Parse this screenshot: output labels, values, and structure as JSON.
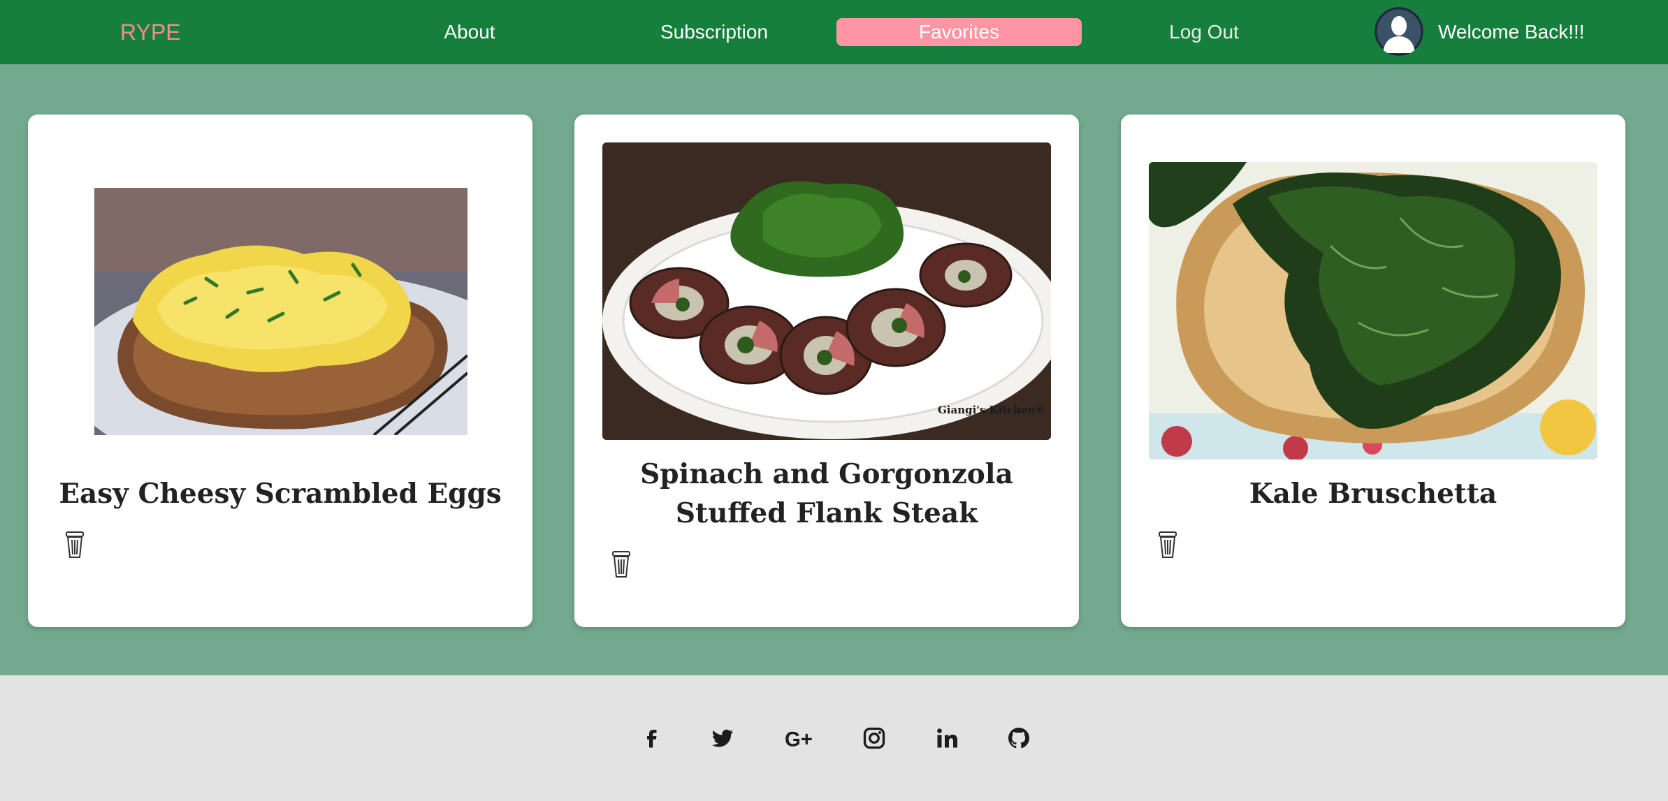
{
  "nav": {
    "brand": "RYPE",
    "items": [
      {
        "label": "About"
      },
      {
        "label": "Subscription"
      },
      {
        "label": "Favorites",
        "active": true
      },
      {
        "label": "Log Out"
      }
    ],
    "welcome": "Welcome Back!!!",
    "active_color": "#ff95a4",
    "bar_color": "#167f3e"
  },
  "favorites": [
    {
      "title": "Easy Cheesy Scrambled Eggs",
      "image": "scrambled eggs on toast"
    },
    {
      "title": "Spinach and Gorgonzola Stuffed Flank Steak",
      "image": "stuffed flank steak with spinach",
      "watermark": "Giangi's Kitchen©"
    },
    {
      "title": "Kale Bruschetta",
      "image": "kale on toasted bread"
    }
  ],
  "footer": {
    "social_icons": [
      "facebook-icon",
      "twitter-icon",
      "google-plus-icon",
      "instagram-icon",
      "linkedin-icon",
      "github-icon"
    ]
  }
}
